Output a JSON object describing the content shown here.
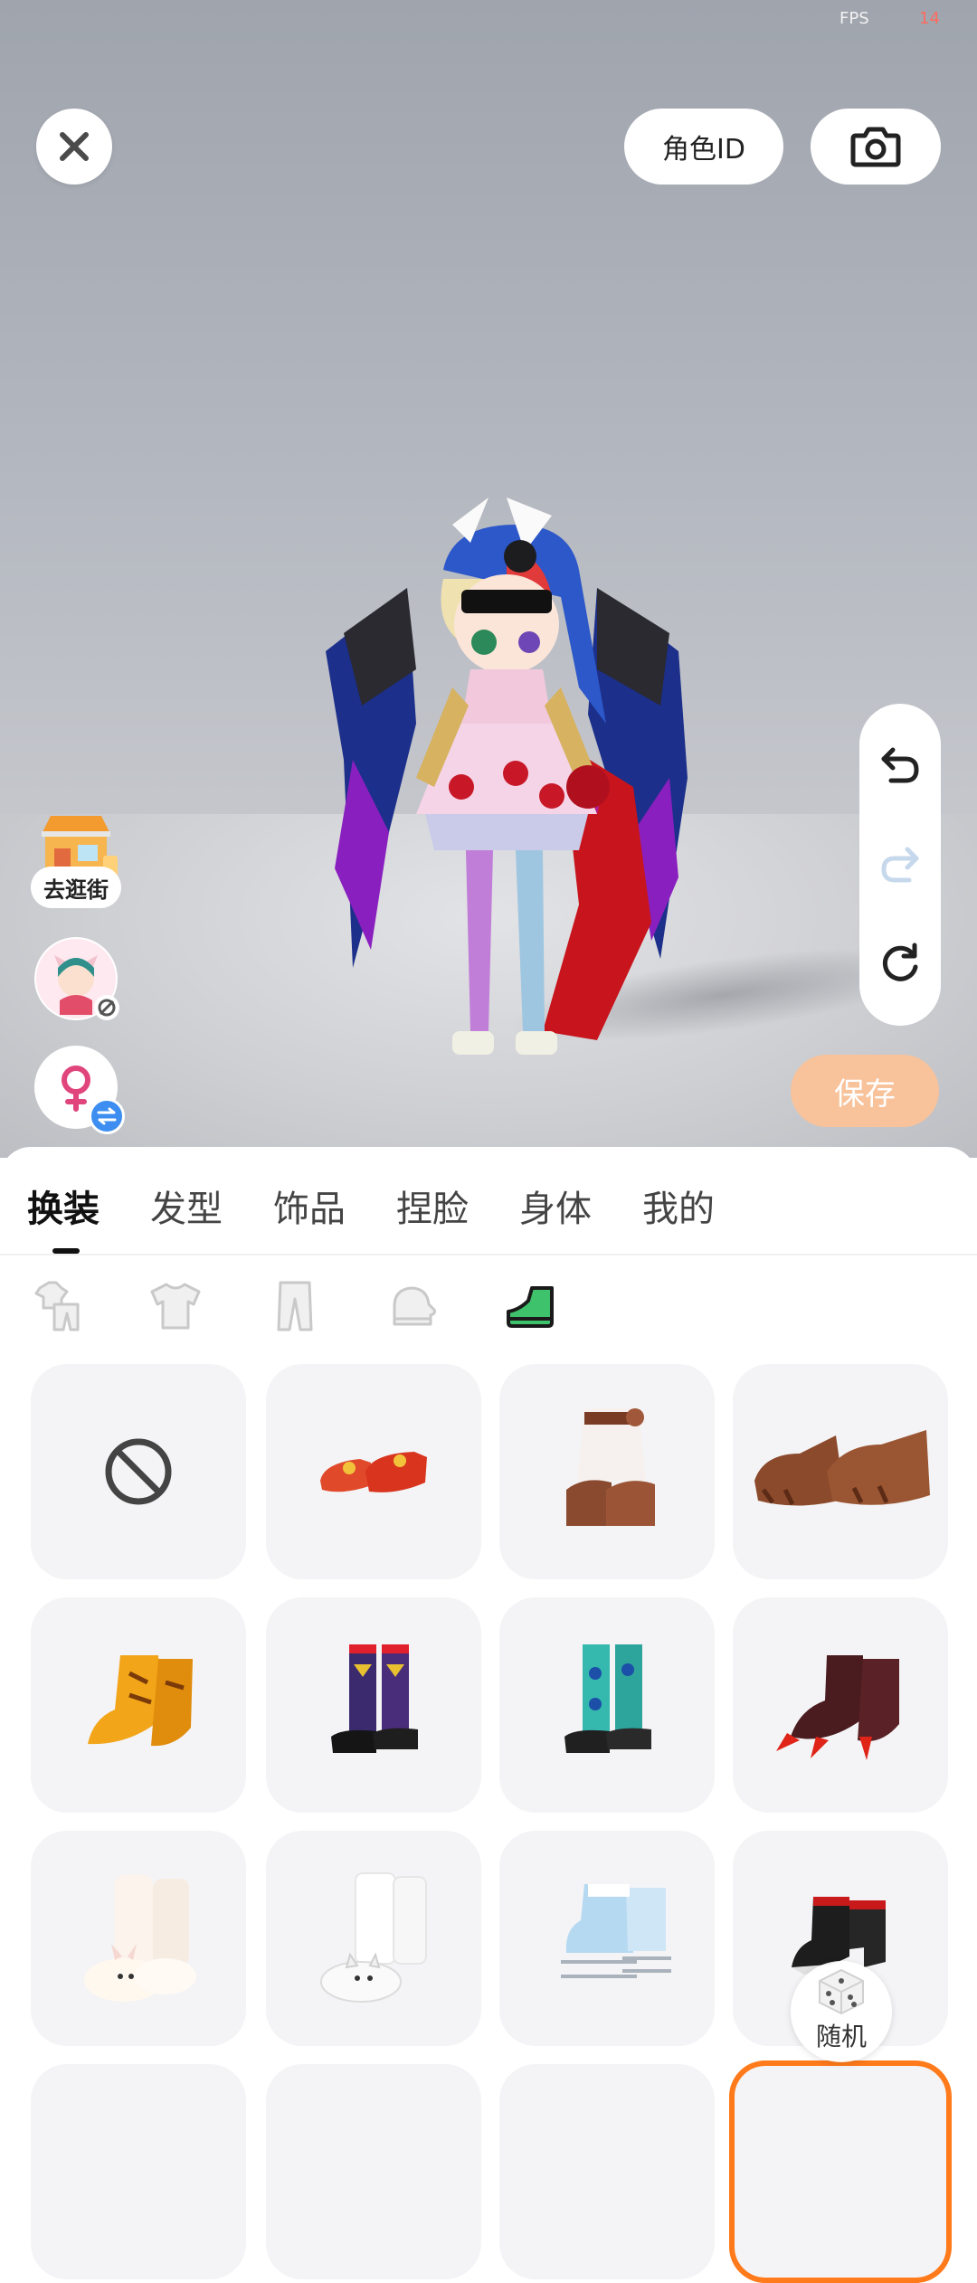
{
  "status": {
    "fps_label": "FPS",
    "fps_value": "14"
  },
  "top": {
    "role_id_label": "角色ID"
  },
  "left": {
    "street_label": "去逛街"
  },
  "save_label": "保存",
  "tabs": [
    {
      "label": "换装",
      "active": true
    },
    {
      "label": "发型",
      "active": false
    },
    {
      "label": "饰品",
      "active": false
    },
    {
      "label": "捏脸",
      "active": false
    },
    {
      "label": "身体",
      "active": false
    },
    {
      "label": "我的",
      "active": false
    }
  ],
  "subcategories": [
    {
      "icon": "outfit-set-icon",
      "active": false
    },
    {
      "icon": "shirt-icon",
      "active": false
    },
    {
      "icon": "pants-icon",
      "active": false
    },
    {
      "icon": "glove-icon",
      "active": false
    },
    {
      "icon": "shoe-icon",
      "active": true
    }
  ],
  "items": [
    {
      "icon": "none-icon"
    },
    {
      "icon": "red-flat-shoes"
    },
    {
      "icon": "fur-boots"
    },
    {
      "icon": "paw-feet"
    },
    {
      "icon": "yellow-claw-boots"
    },
    {
      "icon": "argyle-socks-shoes"
    },
    {
      "icon": "teal-socks-shoes"
    },
    {
      "icon": "red-claw-feet"
    },
    {
      "icon": "bunny-slippers"
    },
    {
      "icon": "cat-slippers"
    },
    {
      "icon": "ice-skates"
    },
    {
      "icon": "black-red-heels"
    }
  ],
  "random_label": "随机",
  "colors": {
    "accent": "#ff7a1a",
    "save_bg": "#f8c29a",
    "gender_badge": "#3d8ef0",
    "gender_icon": "#e0457b"
  }
}
